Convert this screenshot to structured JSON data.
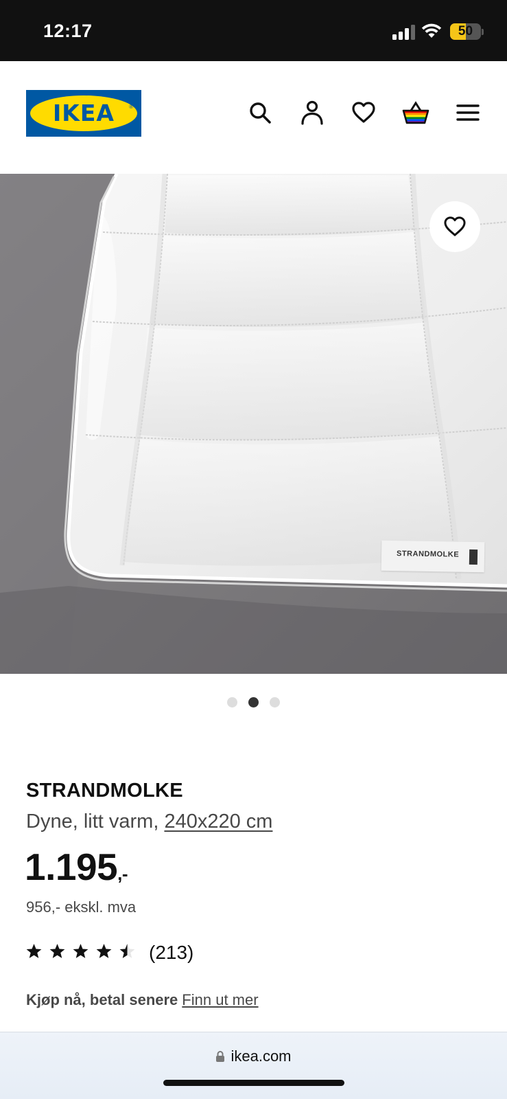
{
  "status_bar": {
    "time": "12:17",
    "battery_percent": 50,
    "battery_label": "50",
    "battery_color": "#f5c518"
  },
  "header": {
    "logo_text": "IKEA",
    "logo_reg": "®",
    "icons": [
      "search-icon",
      "account-icon",
      "heart-icon",
      "shopping-bag-icon",
      "menu-icon"
    ],
    "brand_colors": {
      "blue": "#0058a3",
      "yellow": "#ffdb00"
    }
  },
  "hero": {
    "product_label_text": "STRANDMOLKE",
    "favorite_icon": "heart-icon",
    "carousel_active_index": 1,
    "carousel_count": 3
  },
  "product": {
    "name": "STRANDMOLKE",
    "description": "Dyne, litt varm, ",
    "size": "240x220 cm",
    "price": "1.195",
    "price_suffix": ",-",
    "price_ex_vat": "956,- ekskl. mva",
    "rating": 4.5,
    "rating_max": 5,
    "review_count": "(213)",
    "financing_text": "Kjøp nå, betal senere",
    "financing_link": "Finn ut mer"
  },
  "browser": {
    "url": "ikea.com"
  }
}
